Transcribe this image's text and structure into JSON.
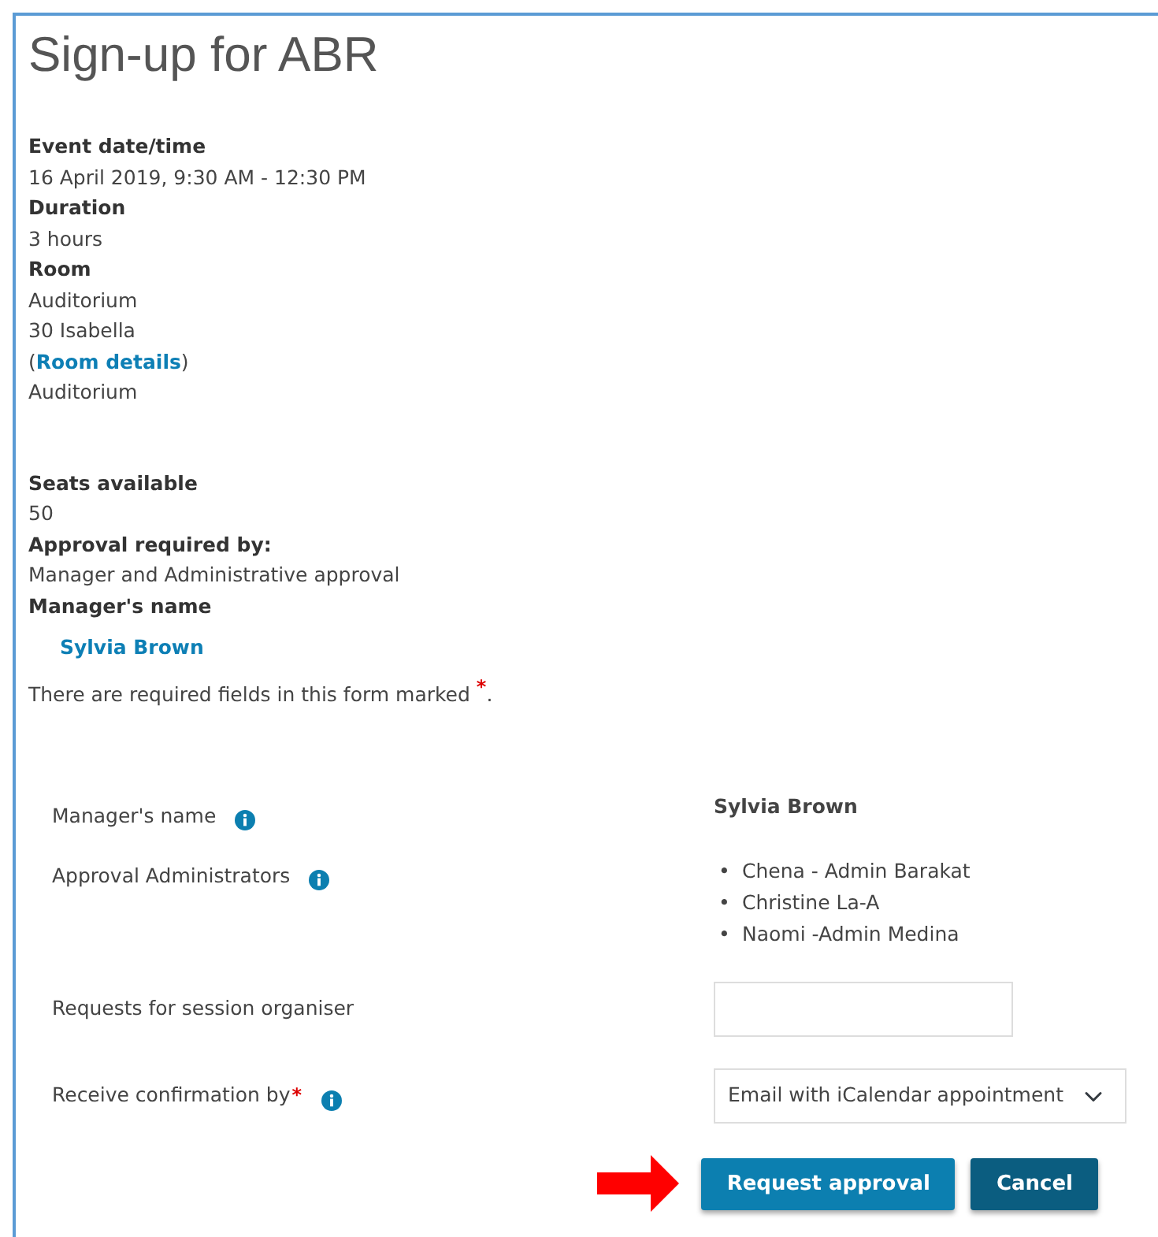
{
  "title": "Sign-up for ABR",
  "detail_groups": [
    {
      "items": [
        {
          "label": "Event date/time",
          "lines": [
            {
              "kind": "text",
              "text": "16 April 2019, 9:30 AM - 12:30 PM"
            }
          ]
        },
        {
          "label": "Duration",
          "lines": [
            {
              "kind": "text",
              "text": "3 hours"
            }
          ]
        },
        {
          "label": "Room",
          "lines": [
            {
              "kind": "text",
              "text": "Auditorium"
            },
            {
              "kind": "text",
              "text": "30 Isabella"
            },
            {
              "kind": "link",
              "before": "(",
              "link": "Room details",
              "after": ")"
            },
            {
              "kind": "text",
              "text": "Auditorium"
            }
          ]
        }
      ]
    },
    {
      "items": [
        {
          "label": "Seats available",
          "lines": [
            {
              "kind": "text",
              "text": "50"
            }
          ]
        },
        {
          "label": "Approval required by:",
          "lines": [
            {
              "kind": "text",
              "text": "Manager and Administrative approval"
            }
          ]
        },
        {
          "label": "Manager's name"
        }
      ]
    }
  ],
  "manager_link": "Sylvia Brown",
  "required_note": {
    "text": "There are required fields in this form marked",
    "mark": "*",
    "end": "."
  },
  "form_rows": [
    {
      "label": "Manager's name",
      "required": false,
      "info": true,
      "kind": "text",
      "value": "Sylvia Brown"
    },
    {
      "label": "Approval Administrators",
      "required": false,
      "info": true,
      "kind": "list",
      "bullet": "•",
      "items": [
        "Chena - Admin Barakat",
        "Christine La-A",
        "Naomi -Admin Medina"
      ]
    },
    {
      "label": "Requests for session organiser",
      "required": false,
      "info": false,
      "kind": "input"
    },
    {
      "label": "Receive confirmation by",
      "required": true,
      "required_mark": "*",
      "info": true,
      "kind": "select",
      "value": "Email with iCalendar appointment"
    }
  ],
  "buttons": [
    {
      "label": "Request approval",
      "kind": "primary"
    },
    {
      "label": "Cancel",
      "kind": "secondary"
    }
  ]
}
